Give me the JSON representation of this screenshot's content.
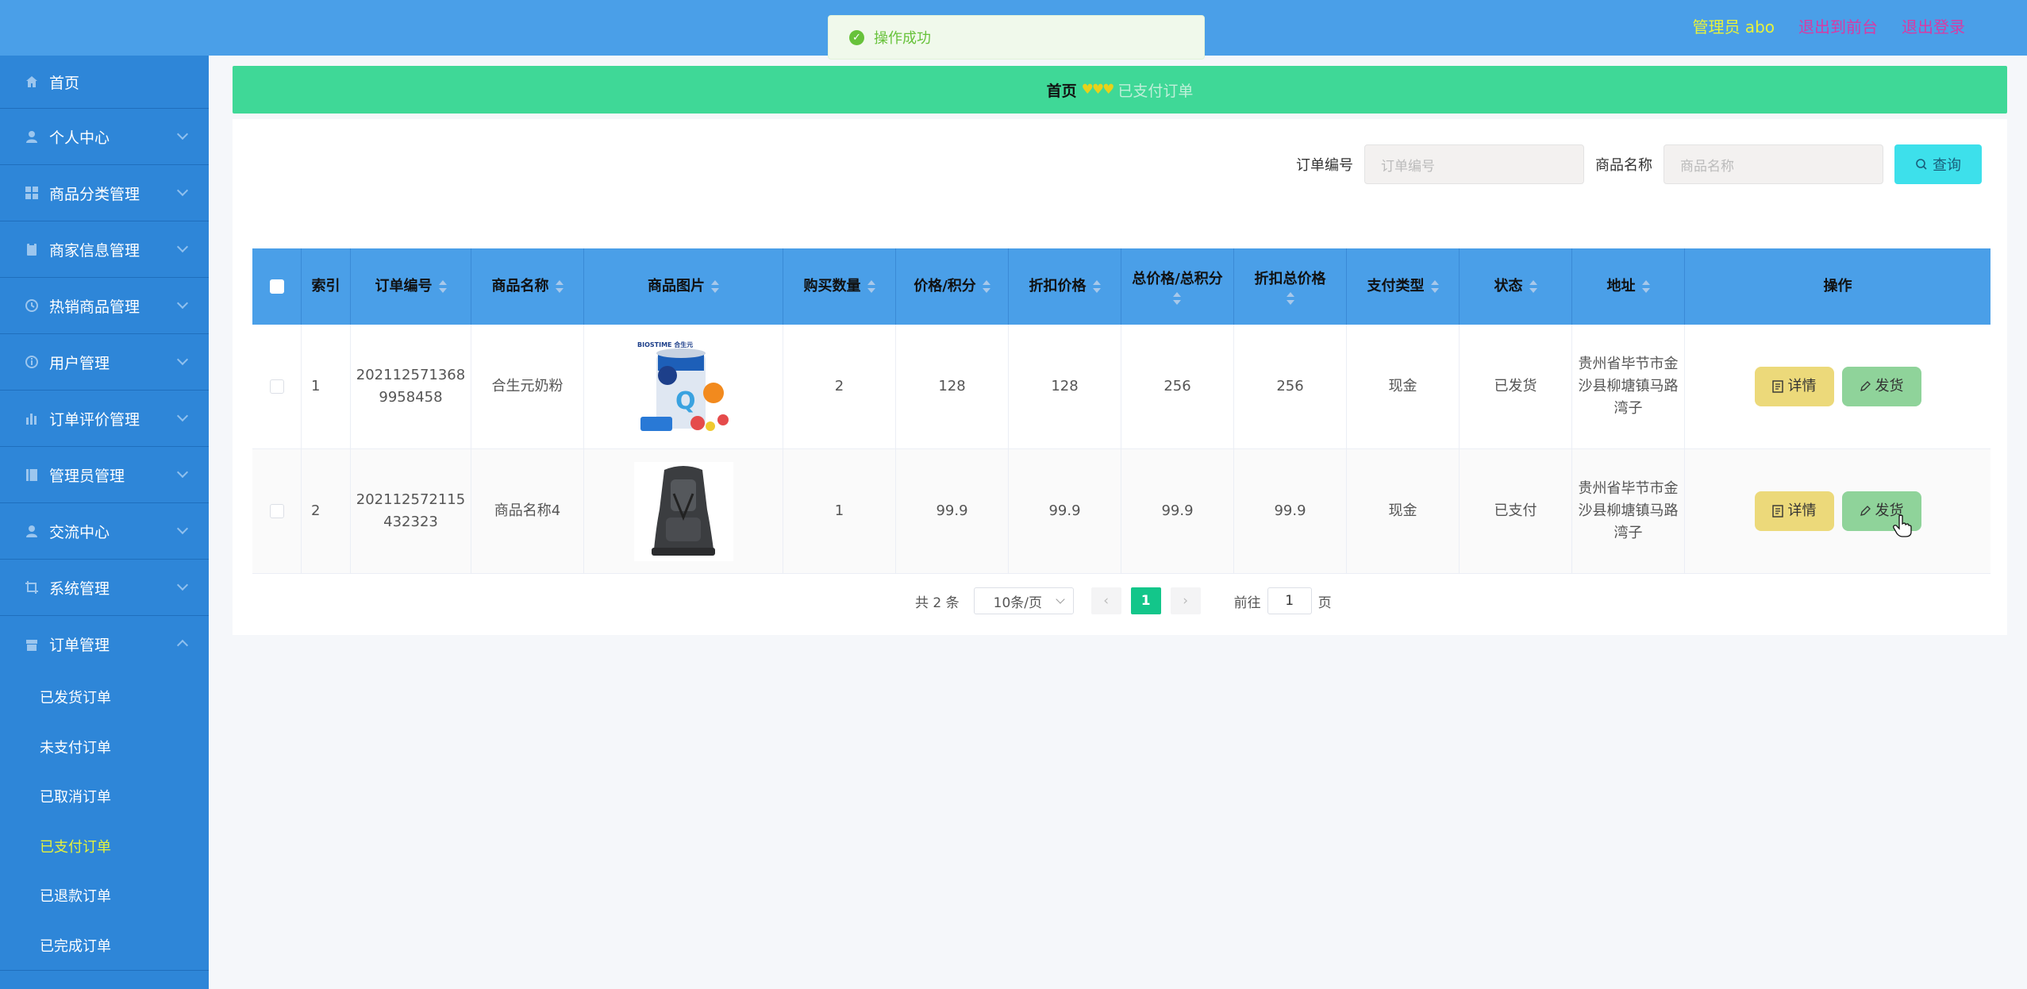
{
  "header": {
    "admin_label": "管理员 abo",
    "back_front": "退出到前台",
    "logout": "退出登录"
  },
  "toast": {
    "message": "操作成功"
  },
  "sidebar": {
    "items": [
      {
        "label": "首页",
        "icon": "home-icon"
      },
      {
        "label": "个人中心",
        "icon": "user-icon"
      },
      {
        "label": "商品分类管理",
        "icon": "grid-icon"
      },
      {
        "label": "商家信息管理",
        "icon": "clipboard-icon"
      },
      {
        "label": "热销商品管理",
        "icon": "clock-icon"
      },
      {
        "label": "用户管理",
        "icon": "info-icon"
      },
      {
        "label": "订单评价管理",
        "icon": "chart-icon"
      },
      {
        "label": "管理员管理",
        "icon": "book-icon"
      },
      {
        "label": "交流中心",
        "icon": "user-icon"
      },
      {
        "label": "系统管理",
        "icon": "crop-icon"
      },
      {
        "label": "订单管理",
        "icon": "box-icon"
      }
    ],
    "order_sub": [
      "已发货订单",
      "未支付订单",
      "已取消订单",
      "已支付订单",
      "已退款订单",
      "已完成订单"
    ]
  },
  "breadcrumb": {
    "home": "首页",
    "hearts": "♥♥♥",
    "current": "已支付订单"
  },
  "search": {
    "order_label": "订单编号",
    "order_placeholder": "订单编号",
    "name_label": "商品名称",
    "name_placeholder": "商品名称",
    "button": "查询"
  },
  "table": {
    "headers": [
      "索引",
      "订单编号",
      "商品名称",
      "商品图片",
      "购买数量",
      "价格/积分",
      "折扣价格",
      "总价格/总积分",
      "折扣总价格",
      "支付类型",
      "状态",
      "地址",
      "操作"
    ],
    "rows": [
      {
        "index": "1",
        "order_no": "2021125713689958458",
        "name": "合生元奶粉",
        "qty": "2",
        "price": "128",
        "discount": "128",
        "total": "256",
        "discount_total": "256",
        "pay_type": "现金",
        "status": "已发货",
        "address": "贵州省毕节市金沙县柳塘镇马路湾子",
        "img_label": "BIOSTIME 合生元"
      },
      {
        "index": "2",
        "order_no": "202112572115432323",
        "name": "商品名称4",
        "qty": "1",
        "price": "99.9",
        "discount": "99.9",
        "total": "99.9",
        "discount_total": "99.9",
        "pay_type": "现金",
        "status": "已支付",
        "address": "贵州省毕节市金沙县柳塘镇马路湾子",
        "img_label": ""
      }
    ],
    "detail_btn": "详情",
    "ship_btn": "发货"
  },
  "pager": {
    "total": "共 2 条",
    "size": "10条/页",
    "page": "1",
    "goto_label": "前往",
    "goto_value": "1",
    "goto_suffix": "页"
  },
  "colors": {
    "header_bg": "#4a9fe8",
    "sidebar_bg": "#2e86d8",
    "breadcrumb_bg": "#3fd897",
    "active_text": "#e7f23a",
    "pager_active": "#13c68a"
  }
}
